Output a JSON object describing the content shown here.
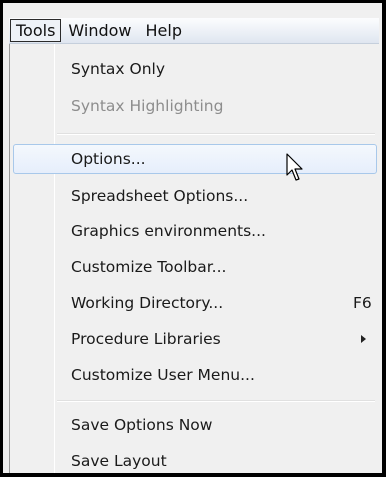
{
  "menubar": {
    "menus": [
      {
        "label": "Tools",
        "open": true
      },
      {
        "label": "Window"
      },
      {
        "label": "Help"
      }
    ]
  },
  "tools_menu": {
    "items": [
      {
        "label": "Syntax Only",
        "enabled": true
      },
      {
        "label": "Syntax Highlighting",
        "enabled": false
      },
      {
        "label": "Options...",
        "enabled": true,
        "highlighted": true
      },
      {
        "label": "Spreadsheet Options...",
        "enabled": true
      },
      {
        "label": "Graphics environments...",
        "enabled": true
      },
      {
        "label": "Customize Toolbar...",
        "enabled": true
      },
      {
        "label": "Working Directory...",
        "enabled": true,
        "shortcut": "F6"
      },
      {
        "label": "Procedure Libraries",
        "enabled": true,
        "submenu": true
      },
      {
        "label": "Customize User Menu...",
        "enabled": true
      },
      {
        "label": "Save Options Now",
        "enabled": true
      },
      {
        "label": "Save Layout",
        "enabled": true
      }
    ]
  },
  "icons": {
    "submenu": "chevron-right-icon",
    "cursor": "mouse-pointer-icon"
  },
  "colors": {
    "highlight_border": "#a8c8ea",
    "disabled_text": "#8d8d8d",
    "menu_background": "#f0f0f0"
  }
}
